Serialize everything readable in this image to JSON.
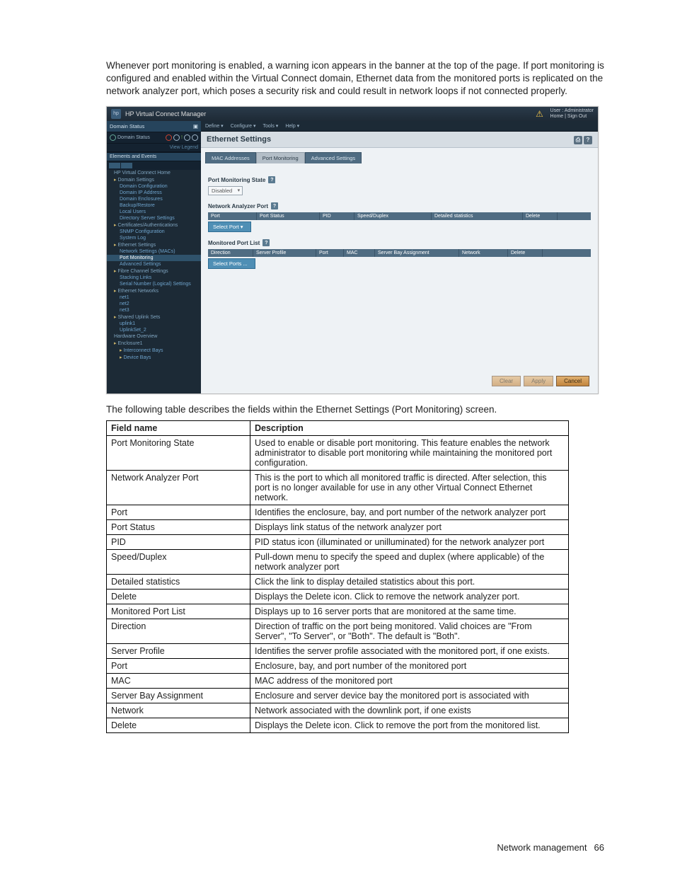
{
  "intro": "Whenever port monitoring is enabled, a warning icon appears in the banner at the top of the page. If port monitoring is configured and enabled within the Virtual Connect domain, Ethernet data from the monitored ports is replicated on the network analyzer port, which poses a security risk and could result in network loops if not connected properly.",
  "shot": {
    "app_title": "HP Virtual Connect Manager",
    "logo_text": "hp",
    "user_line1": "User : Administrator",
    "user_line2": "Home | Sign Out",
    "menu": {
      "define": "Define ▾",
      "configure": "Configure ▾",
      "tools": "Tools ▾",
      "help": "Help ▾"
    },
    "sidebar": {
      "status_head": "Domain Status",
      "status_row": "Domain Status",
      "legend": "View Legend",
      "ee_head": "Elements and Events",
      "items": [
        {
          "label": "HP Virtual Connect Home",
          "cls": "",
          "sub": false
        },
        {
          "label": "Domain Settings",
          "cls": "folder",
          "sub": false
        },
        {
          "label": "Domain Configuration",
          "cls": "blue",
          "sub": true
        },
        {
          "label": "Domain IP Address",
          "cls": "blue",
          "sub": true
        },
        {
          "label": "Domain Enclosures",
          "cls": "blue",
          "sub": true
        },
        {
          "label": "Backup/Restore",
          "cls": "blue",
          "sub": true
        },
        {
          "label": "Local Users",
          "cls": "blue",
          "sub": true
        },
        {
          "label": "Directory Server Settings",
          "cls": "blue",
          "sub": true
        },
        {
          "label": "Certificates/Authentications",
          "cls": "folder",
          "sub": false
        },
        {
          "label": "SNMP Configuration",
          "cls": "blue",
          "sub": true
        },
        {
          "label": "System Log",
          "cls": "blue",
          "sub": true
        },
        {
          "label": "Ethernet Settings",
          "cls": "folder",
          "sub": false
        },
        {
          "label": "Network Settings (MACs)",
          "cls": "blue",
          "sub": true
        },
        {
          "label": "Port Monitoring",
          "cls": "active",
          "sub": true
        },
        {
          "label": "Advanced Settings",
          "cls": "blue",
          "sub": true
        },
        {
          "label": "Fibre Channel Settings",
          "cls": "folder",
          "sub": false
        },
        {
          "label": "Stacking Links",
          "cls": "blue",
          "sub": true
        },
        {
          "label": "Serial Number (Logical) Settings",
          "cls": "blue",
          "sub": true
        },
        {
          "label": "Ethernet Networks",
          "cls": "folder",
          "sub": false
        },
        {
          "label": "net1",
          "cls": "blue",
          "sub": true
        },
        {
          "label": "net2",
          "cls": "blue",
          "sub": true
        },
        {
          "label": "net3",
          "cls": "blue",
          "sub": true
        },
        {
          "label": "Shared Uplink Sets",
          "cls": "folder",
          "sub": false
        },
        {
          "label": "uplink1",
          "cls": "blue",
          "sub": true
        },
        {
          "label": "UplinkSet_2",
          "cls": "blue",
          "sub": true
        },
        {
          "label": "Hardware Overview",
          "cls": "",
          "sub": false
        },
        {
          "label": "Enclosure1",
          "cls": "folder",
          "sub": false
        },
        {
          "label": "Interconnect Bays",
          "cls": "folder blue",
          "sub": true
        },
        {
          "label": "Device Bays",
          "cls": "folder blue",
          "sub": true
        }
      ]
    },
    "panel": {
      "title": "Ethernet Settings",
      "tabs": {
        "mac": "MAC Addresses",
        "pm": "Port Monitoring",
        "adv": "Advanced Settings"
      },
      "pm_state_label": "Port Monitoring State",
      "pm_state_value": "Disabled",
      "nap_label": "Network Analyzer Port",
      "nap_add": "Select Port ▾",
      "nap_cols": [
        "Port",
        "Port Status",
        "PID",
        "Speed/Duplex",
        "Detailed statistics",
        "Delete"
      ],
      "mpl_label": "Monitored Port List",
      "mpl_add": "Select Ports ...",
      "mpl_cols": [
        "Direction",
        "Server Profile",
        "Port",
        "MAC",
        "Server Bay Assignment",
        "Network",
        "Delete"
      ],
      "btn_clear": "Clear",
      "btn_apply": "Apply",
      "btn_cancel": "Cancel"
    }
  },
  "caption": "The following table describes the fields within the Ethernet Settings (Port Monitoring) screen.",
  "table": {
    "head_field": "Field name",
    "head_desc": "Description",
    "rows": [
      {
        "f": "Port Monitoring State",
        "d": "Used to enable or disable port monitoring. This feature enables the network administrator to disable port monitoring while maintaining the monitored port configuration."
      },
      {
        "f": "Network Analyzer Port",
        "d": "This is the port to which all monitored traffic is directed. After selection, this port is no longer available for use in any other Virtual Connect Ethernet network."
      },
      {
        "f": "Port",
        "d": "Identifies the enclosure, bay, and port number of the network analyzer port"
      },
      {
        "f": "Port Status",
        "d": "Displays link status of the network analyzer port"
      },
      {
        "f": "PID",
        "d": "PID status icon (illuminated or unilluminated) for the network analyzer port"
      },
      {
        "f": "Speed/Duplex",
        "d": "Pull-down menu to specify the speed and duplex (where applicable) of the network analyzer port"
      },
      {
        "f": "Detailed statistics",
        "d": "Click the link to display detailed statistics about this port."
      },
      {
        "f": "Delete",
        "d": "Displays the Delete icon. Click to remove the network analyzer port."
      },
      {
        "f": "Monitored Port List",
        "d": "Displays up to 16 server ports that are monitored at the same time."
      },
      {
        "f": "Direction",
        "d": "Direction of traffic on the port being monitored. Valid choices are \"From Server\", \"To Server\", or \"Both\". The default is \"Both\"."
      },
      {
        "f": "Server Profile",
        "d": "Identifies the server profile associated with the monitored port, if one exists."
      },
      {
        "f": "Port",
        "d": "Enclosure, bay, and port number of the monitored port"
      },
      {
        "f": "MAC",
        "d": "MAC address of the monitored port"
      },
      {
        "f": "Server Bay Assignment",
        "d": "Enclosure and server device bay the monitored port is associated with"
      },
      {
        "f": "Network",
        "d": "Network associated with the downlink port, if one exists"
      },
      {
        "f": "Delete",
        "d": "Displays the Delete icon. Click to remove the port from the monitored list."
      }
    ]
  },
  "footer_text": "Network management",
  "footer_page": "66"
}
